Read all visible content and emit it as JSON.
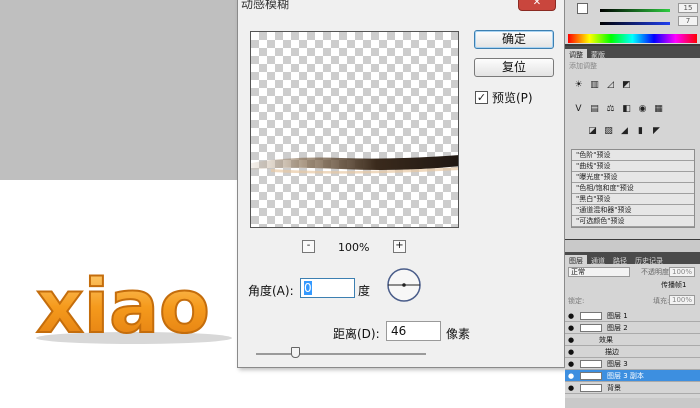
{
  "dialog": {
    "title": "动感模糊",
    "ok_label": "确定",
    "reset_label": "复位",
    "preview_label": "预览(P)",
    "preview_checked": true,
    "zoom_out_label": "-",
    "zoom_in_label": "+",
    "zoom": "100%",
    "angle_label": "角度(A):",
    "angle_value": "0",
    "angle_unit": "度",
    "distance_label": "距离(D):",
    "distance_value": "46",
    "distance_unit": "像素",
    "distance_slider_fraction": 0.23,
    "close_symbol": "✕"
  },
  "canvas": {
    "text_art": "xiao",
    "accent_color": "#f39a1e"
  },
  "color_panel": {
    "green_value": "15",
    "blue_value": "7"
  },
  "adjust_panel": {
    "tabs": [
      "调整",
      "蒙版"
    ],
    "hint": "添加调整",
    "presets": [
      "\"色阶\"预设",
      "\"曲线\"预设",
      "\"曝光度\"预设",
      "\"色相/饱和度\"预设",
      "\"黑白\"预设",
      "\"通道混和器\"预设",
      "\"可选颜色\"预设"
    ]
  },
  "layers_panel": {
    "tabs": [
      "图层",
      "通道",
      "路径",
      "历史记录"
    ],
    "blend_mode": "正常",
    "opacity_label": "不透明度:",
    "opacity": "100%",
    "propagate_label": "传播帧1",
    "lock_label": "锁定:",
    "fill_label": "填充:",
    "fill": "100%",
    "layers": [
      {
        "name": "图层 1",
        "selected": false
      },
      {
        "name": "图层 2",
        "selected": false
      },
      {
        "name": "效果",
        "selected": false
      },
      {
        "name": "描边",
        "selected": false
      },
      {
        "name": "图层 3",
        "selected": false
      },
      {
        "name": "图层 3 副本",
        "selected": true
      },
      {
        "name": "背景",
        "selected": false
      }
    ]
  }
}
